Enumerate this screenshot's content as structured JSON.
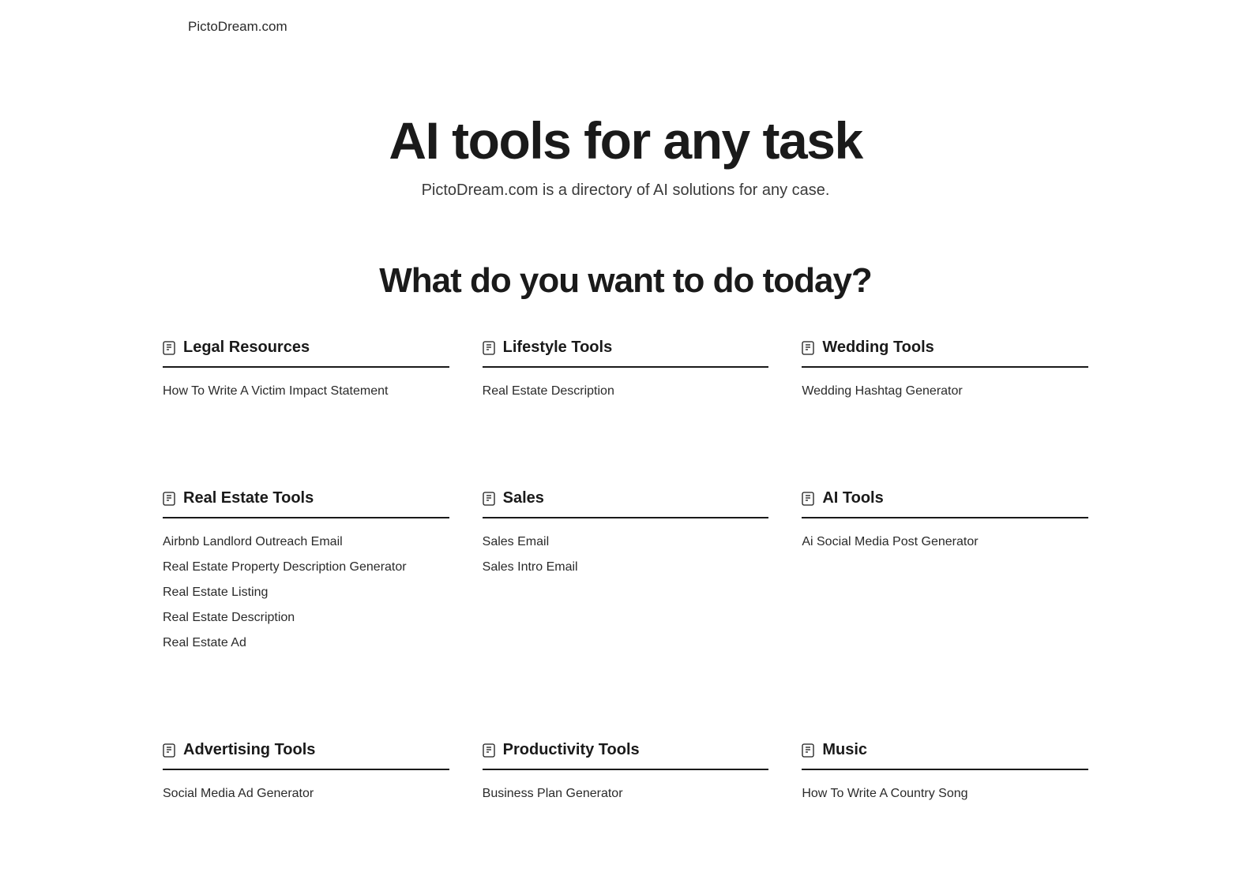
{
  "header": {
    "logo": "PictoDream.com"
  },
  "hero": {
    "title": "AI tools for any task",
    "subtitle": "PictoDream.com is a directory of AI solutions for any case."
  },
  "section_title": "What do you want to do today?",
  "categories": [
    {
      "title": "Legal Resources",
      "links": [
        "How To Write A Victim Impact Statement"
      ]
    },
    {
      "title": "Lifestyle Tools",
      "links": [
        "Real Estate Description"
      ]
    },
    {
      "title": "Wedding Tools",
      "links": [
        "Wedding Hashtag Generator"
      ]
    },
    {
      "title": "Real Estate Tools",
      "links": [
        "Airbnb Landlord Outreach Email",
        "Real Estate Property Description Generator",
        "Real Estate Listing",
        "Real Estate Description",
        "Real Estate Ad"
      ]
    },
    {
      "title": "Sales",
      "links": [
        "Sales Email",
        "Sales Intro Email"
      ]
    },
    {
      "title": "AI Tools",
      "links": [
        "Ai Social Media Post Generator"
      ]
    },
    {
      "title": "Advertising Tools",
      "links": [
        "Social Media Ad Generator"
      ]
    },
    {
      "title": "Productivity Tools",
      "links": [
        "Business Plan Generator"
      ]
    },
    {
      "title": "Music",
      "links": [
        "How To Write A Country Song"
      ]
    }
  ]
}
